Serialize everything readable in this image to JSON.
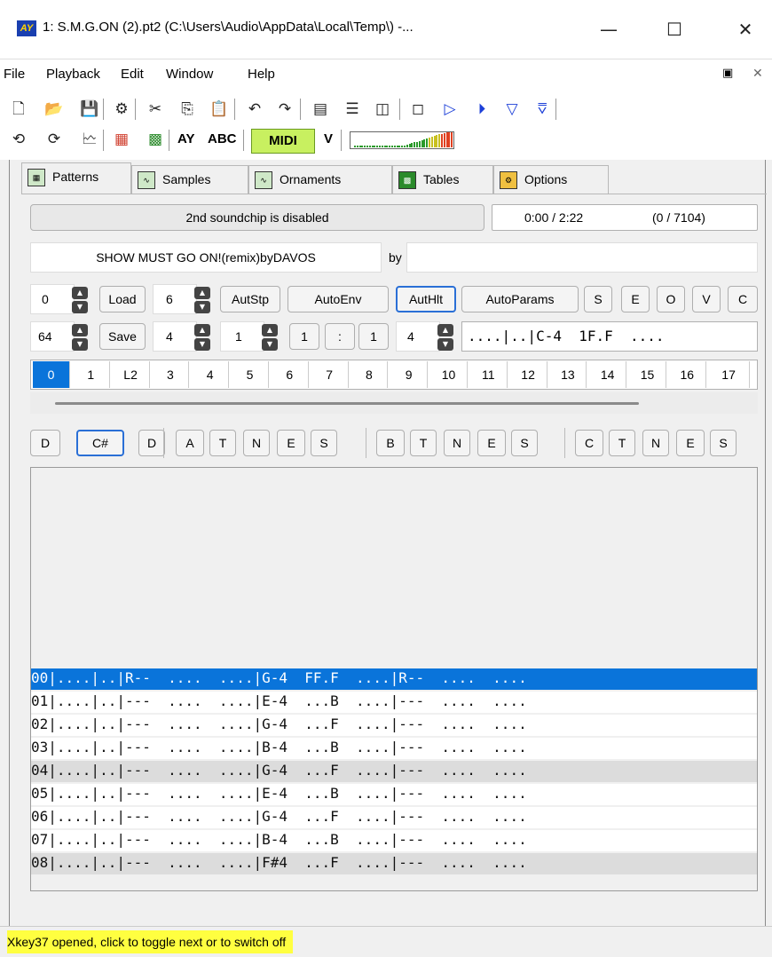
{
  "window": {
    "icon_text": "AY",
    "title": "1: S.M.G.ON (2).pt2 (C:\\Users\\Audio\\AppData\\Local\\Temp\\) -...",
    "minimize": "—",
    "maximize": "☐",
    "close": "✕"
  },
  "menu": {
    "items": [
      "File",
      "Playback",
      "Edit",
      "Window",
      "Help"
    ],
    "mdi_restore": "▣",
    "mdi_close": "✕"
  },
  "toolbar": {
    "ay_label": "AY",
    "abc_label": "ABC",
    "midi_label": "MIDI",
    "v_label": "V",
    "midi_color": "#c8f060"
  },
  "tabs": [
    "Patterns",
    "Samples",
    "Ornaments",
    "Tables",
    "Options"
  ],
  "info": {
    "soundchip_status": "2nd soundchip is disabled",
    "time": "0:00 / 2:22",
    "position": "(0 / 7104)",
    "title": "SHOW MUST GO ON!(remix)byDAVOS",
    "by_label": "by",
    "author": ""
  },
  "controls": {
    "row1": {
      "spin1_value": "0",
      "load_label": "Load",
      "spin2_value": "6",
      "autstp_label": "AutStp",
      "autoenv_label": "AutoEnv",
      "authlt_label": "AutHlt",
      "autoparams_label": "AutoParams",
      "s_label": "S",
      "e_label": "E",
      "o_label": "O",
      "v_label": "V",
      "c_label": "C"
    },
    "row2": {
      "spin1_value": "64",
      "save_label": "Save",
      "spin2_value": "4",
      "spin3_value": "1",
      "ratio_a": "1",
      "ratio_sep": ":",
      "ratio_b": "1",
      "spin4_value": "4",
      "preview_line": "....|..|C-4  1F.F  ...."
    }
  },
  "positions": [
    "0",
    "1",
    "L2",
    "3",
    "4",
    "5",
    "6",
    "7",
    "8",
    "9",
    "10",
    "11",
    "12",
    "13",
    "14",
    "15",
    "16",
    "17"
  ],
  "channel_buttons": [
    "D",
    "C#",
    "D",
    "A",
    "T",
    "N",
    "E",
    "S",
    "B",
    "T",
    "N",
    "E",
    "S",
    "C",
    "T",
    "N",
    "E",
    "S"
  ],
  "pattern_rows": [
    "00|....|..|R--  ....  ....|G-4  FF.F  ....|R--  ....  ....",
    "01|....|..|---  ....  ....|E-4  ...B  ....|---  ....  ....",
    "02|....|..|---  ....  ....|G-4  ...F  ....|---  ....  ....",
    "03|....|..|---  ....  ....|B-4  ...B  ....|---  ....  ....",
    "04|....|..|---  ....  ....|G-4  ...F  ....|---  ....  ....",
    "05|....|..|---  ....  ....|E-4  ...B  ....|---  ....  ....",
    "06|....|..|---  ....  ....|G-4  ...F  ....|---  ....  ....",
    "07|....|..|---  ....  ....|B-4  ...B  ....|---  ....  ....",
    "08|....|..|---  ....  ....|F#4  ...F  ....|---  ....  ...."
  ],
  "pattern_colors": {
    "current_row": "#0a74da",
    "highlight_row": "#dcdcdc",
    "normal_row": "#ffffff"
  },
  "status": {
    "message": "Xkey37 opened, click to toggle next or to switch off",
    "color": "#ffff40"
  }
}
